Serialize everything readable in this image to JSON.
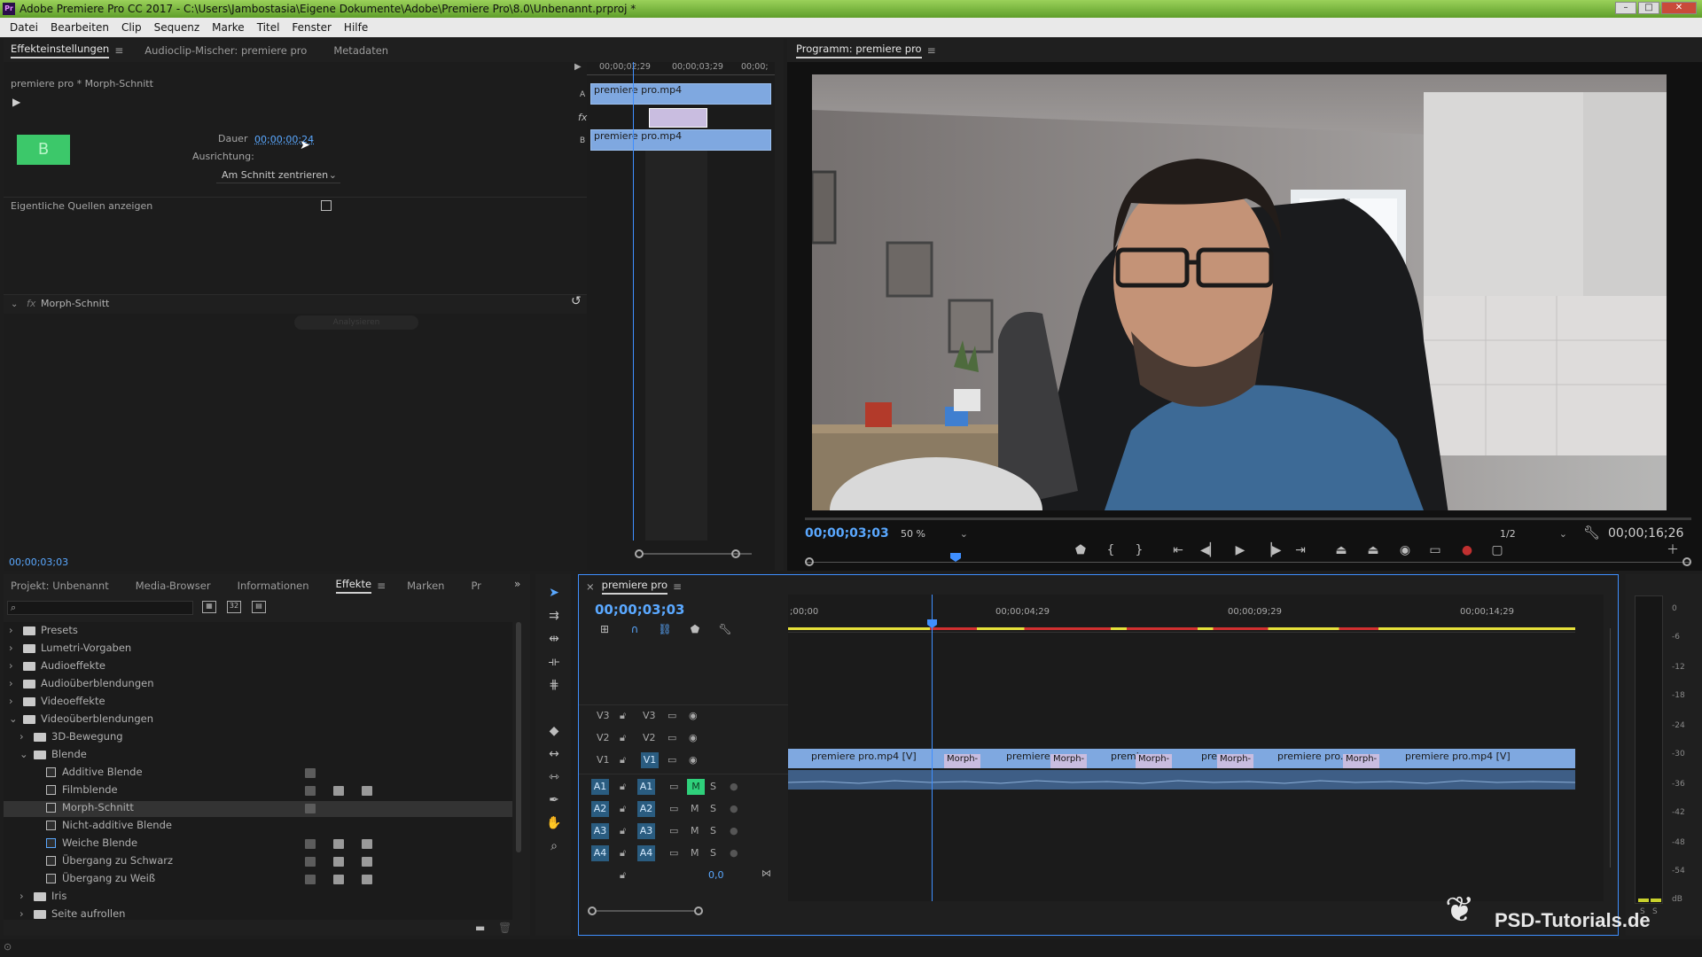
{
  "window": {
    "title": "Adobe Premiere Pro CC 2017 - C:\\Users\\Jambostasia\\Eigene Dokumente\\Adobe\\Premiere Pro\\8.0\\Unbenannt.prproj *",
    "app_icon": "Pr"
  },
  "menu": [
    "Datei",
    "Bearbeiten",
    "Clip",
    "Sequenz",
    "Marke",
    "Titel",
    "Fenster",
    "Hilfe"
  ],
  "source_panel": {
    "tabs": [
      "Effekteinstellungen",
      "Audioclip-Mischer: premiere pro",
      "Metadaten"
    ],
    "header": "premiere pro * Morph-Schnitt",
    "dauer_label": "Dauer",
    "dauer_value": "00;00;00;24",
    "ausrichtung_label": "Ausrichtung:",
    "ausrichtung_value": "Am Schnitt zentrieren",
    "quellen_label": "Eigentliche Quellen anzeigen",
    "effect_name": "Morph-Schnitt",
    "analyse_label": "Analysieren",
    "timecode_bottom": "00;00;03;03",
    "mini_ruler": [
      "00;00;02;29",
      "00;00;03;29",
      "00;00;"
    ],
    "mini_track_a": "A",
    "mini_track_b": "B",
    "clip_a": "premiere pro.mp4",
    "clip_b": "premiere pro.mp4"
  },
  "program_monitor": {
    "title": "Programm: premiere pro",
    "timecode": "00;00;03;03",
    "zoom": "50 %",
    "resolution": "1/2",
    "duration": "00;00;16;26"
  },
  "project_panel": {
    "tabs": [
      "Projekt: Unbenannt",
      "Media-Browser",
      "Informationen",
      "Effekte",
      "Marken",
      "Pr"
    ],
    "search_placeholder": "",
    "tree": [
      {
        "label": "Presets",
        "level": 0,
        "expanded": false,
        "type": "folder"
      },
      {
        "label": "Lumetri-Vorgaben",
        "level": 0,
        "expanded": false,
        "type": "folder"
      },
      {
        "label": "Audioeffekte",
        "level": 0,
        "expanded": false,
        "type": "folder"
      },
      {
        "label": "Audioüberblendungen",
        "level": 0,
        "expanded": false,
        "type": "folder"
      },
      {
        "label": "Videoeffekte",
        "level": 0,
        "expanded": false,
        "type": "folder"
      },
      {
        "label": "Videoüberblendungen",
        "level": 0,
        "expanded": true,
        "type": "folder"
      },
      {
        "label": "3D-Bewegung",
        "level": 1,
        "expanded": false,
        "type": "folder"
      },
      {
        "label": "Blende",
        "level": 1,
        "expanded": true,
        "type": "folder"
      },
      {
        "label": "Additive Blende",
        "level": 2,
        "type": "effect"
      },
      {
        "label": "Filmblende",
        "level": 2,
        "type": "effect"
      },
      {
        "label": "Morph-Schnitt",
        "level": 2,
        "type": "effect",
        "selected": true
      },
      {
        "label": "Nicht-additive Blende",
        "level": 2,
        "type": "effect"
      },
      {
        "label": "Weiche Blende",
        "level": 2,
        "type": "effect"
      },
      {
        "label": "Übergang zu Schwarz",
        "level": 2,
        "type": "effect"
      },
      {
        "label": "Übergang zu Weiß",
        "level": 2,
        "type": "effect"
      },
      {
        "label": "Iris",
        "level": 1,
        "expanded": false,
        "type": "folder"
      },
      {
        "label": "Seite aufrollen",
        "level": 1,
        "expanded": false,
        "type": "folder"
      }
    ]
  },
  "timeline": {
    "tab": "premiere pro",
    "timecode": "00;00;03;03",
    "ruler": [
      ";00;00",
      "00;00;04;29",
      "00;00;09;29",
      "00;00;14;29"
    ],
    "video_tracks": [
      {
        "src": "V3",
        "tgt": "V3"
      },
      {
        "src": "V2",
        "tgt": "V2"
      },
      {
        "src": "V1",
        "tgt": "V1"
      }
    ],
    "audio_tracks": [
      {
        "src": "A1",
        "tgt": "A1",
        "m": "M",
        "s": "S"
      },
      {
        "src": "A2",
        "tgt": "A2",
        "m": "M",
        "s": "S"
      },
      {
        "src": "A3",
        "tgt": "A3",
        "m": "M",
        "s": "S"
      },
      {
        "src": "A4",
        "tgt": "A4",
        "m": "M",
        "s": "S"
      }
    ],
    "master_value": "0,0",
    "v1_clips": [
      "premiere pro.mp4 [V]",
      "premiere",
      "premi",
      "pre",
      "premiere pro.",
      "premiere pro.mp4 [V]"
    ],
    "transitions": [
      "Morph-",
      "Morph-",
      "Morph-",
      "Morph-",
      "Morph-"
    ]
  },
  "audio_meter": {
    "scale": [
      "0",
      "-6",
      "-12",
      "-18",
      "-24",
      "-30",
      "-36",
      "-42",
      "-48",
      "-54",
      "dB"
    ],
    "solo": [
      "S",
      "S"
    ]
  },
  "watermark": "PSD-Tutorials.de",
  "colors": {
    "accent": "#2d8ceb",
    "clip": "#7fa8e0",
    "titlebar": "#7cbf3f"
  }
}
